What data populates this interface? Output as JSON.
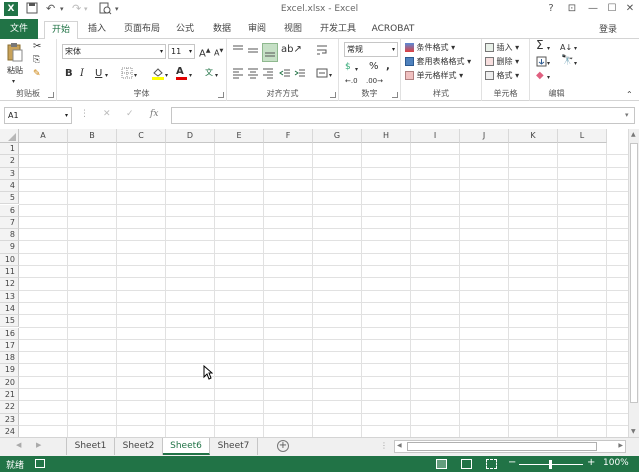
{
  "title": {
    "text": "Excel.xlsx - Excel",
    "help": "?",
    "restore": "⊡",
    "minimize": "—",
    "maximize": "☐",
    "close": "✕"
  },
  "tabs": [
    "文件",
    "开始",
    "插入",
    "页面布局",
    "公式",
    "数据",
    "审阅",
    "视图",
    "开发工具",
    "ACROBAT"
  ],
  "signin": "登录",
  "clipboard": {
    "paste": "粘贴",
    "label": "剪贴板"
  },
  "font": {
    "name": "宋体",
    "size": "11",
    "bold": "B",
    "italic": "I",
    "underline": "U",
    "grow": "A",
    "shrink": "A",
    "color_letter": "A",
    "label": "字体"
  },
  "alignment": {
    "label": "对齐方式"
  },
  "number": {
    "format": "常规",
    "percent": "%",
    "comma": ",",
    "label": "数字"
  },
  "styles": {
    "conditional": "条件格式",
    "table": "套用表格格式",
    "cell": "单元格样式",
    "label": "样式"
  },
  "cells": {
    "insert": "插入",
    "delete": "删除",
    "format": "格式",
    "label": "单元格"
  },
  "editing": {
    "sum": "Σ",
    "sort": "A↓",
    "label": "编辑"
  },
  "formula": {
    "namebox": "A1",
    "fx": "fx",
    "cancel": "✕",
    "enter": "✓"
  },
  "columns": [
    "A",
    "B",
    "C",
    "D",
    "E",
    "F",
    "G",
    "H",
    "I",
    "J",
    "K",
    "L"
  ],
  "rows": [
    "1",
    "2",
    "3",
    "4",
    "5",
    "6",
    "7",
    "8",
    "9",
    "10",
    "11",
    "12",
    "13",
    "14",
    "15",
    "16",
    "17",
    "18",
    "19",
    "20",
    "21",
    "22",
    "23",
    "24"
  ],
  "sheets": [
    "Sheet1",
    "Sheet2",
    "Sheet6",
    "Sheet7"
  ],
  "active_sheet": "Sheet6",
  "add_sheet": "+",
  "status": {
    "ready": "就绪",
    "zoom": "100%",
    "minus": "−",
    "plus": "+"
  },
  "colors": {
    "accent": "#217346",
    "gridline": "#e1e1e1"
  }
}
